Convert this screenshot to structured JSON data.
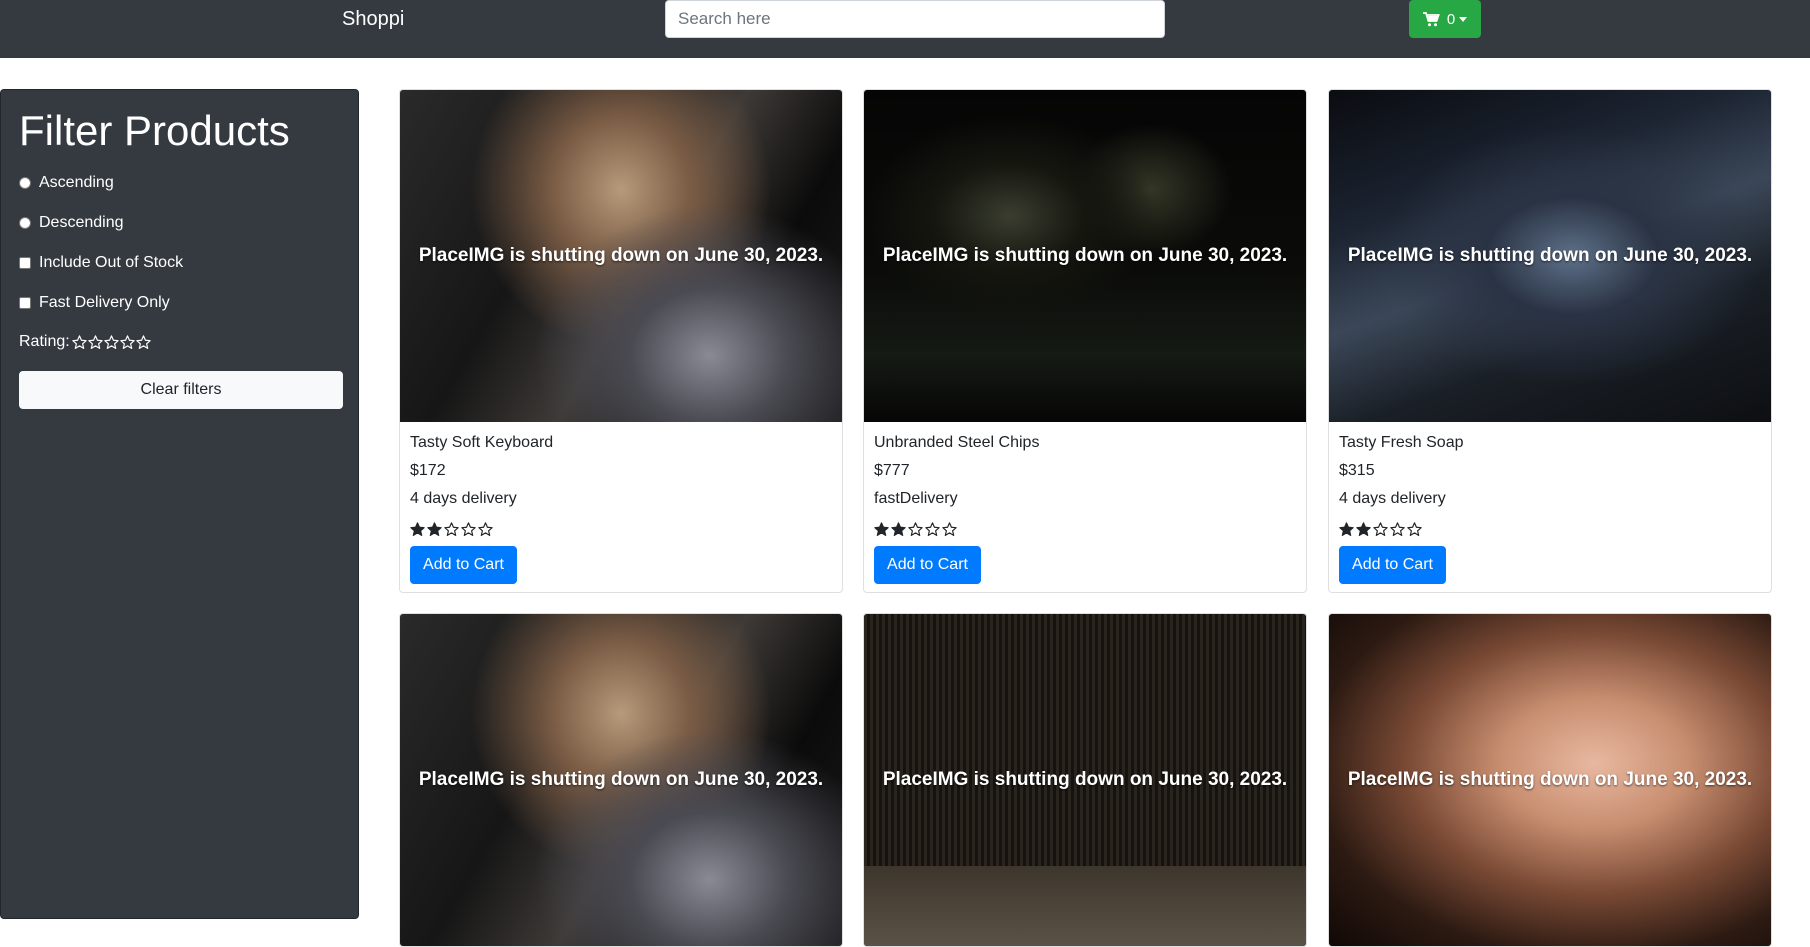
{
  "navbar": {
    "brand": "Shoppi",
    "search_placeholder": "Search here",
    "cart_count": "0",
    "cart_color": "#28a745"
  },
  "sidebar": {
    "title": "Filter Products",
    "options": {
      "ascending": "Ascending",
      "descending": "Descending",
      "include_out_of_stock": "Include Out of Stock",
      "fast_delivery_only": "Fast Delivery Only"
    },
    "rating_label": "Rating:",
    "rating_value": 0,
    "clear_button": "Clear filters"
  },
  "products": [
    {
      "name": "Tasty Soft Keyboard",
      "price": "$172",
      "delivery": "4 days delivery",
      "rating": 2,
      "image_caption": "PlaceIMG is shutting down on June 30, 2023.",
      "add_label": "Add to Cart"
    },
    {
      "name": "Unbranded Steel Chips",
      "price": "$777",
      "delivery": "fastDelivery",
      "rating": 2,
      "image_caption": "PlaceIMG is shutting down on June 30, 2023.",
      "add_label": "Add to Cart"
    },
    {
      "name": "Tasty Fresh Soap",
      "price": "$315",
      "delivery": "4 days delivery",
      "rating": 2,
      "image_caption": "PlaceIMG is shutting down on June 30, 2023.",
      "add_label": "Add to Cart"
    },
    {
      "image_caption": "PlaceIMG is shutting down on June 30, 2023."
    },
    {
      "image_caption": "PlaceIMG is shutting down on June 30, 2023."
    },
    {
      "image_caption": "PlaceIMG is shutting down on June 30, 2023."
    }
  ],
  "colors": {
    "navbar_bg": "#343a40",
    "primary_button": "#007bff",
    "clear_button_bg": "#f8f9fa"
  },
  "icons": [
    "cart-icon",
    "star-icon"
  ]
}
